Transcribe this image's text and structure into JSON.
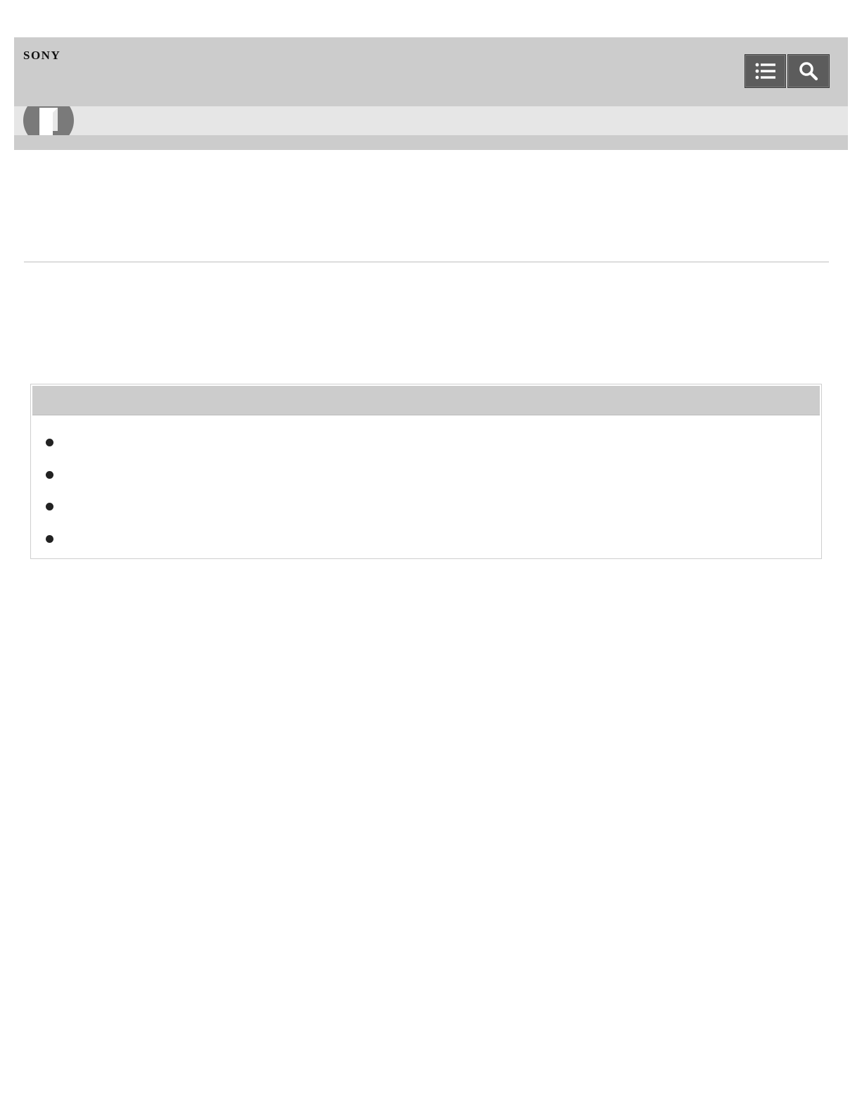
{
  "header": {
    "brand": "SONY",
    "buttons": [
      {
        "icon": "list-icon"
      },
      {
        "icon": "search-icon"
      }
    ],
    "section_icon": "book-icon"
  },
  "note_box": {
    "items": [
      "",
      "",
      "",
      ""
    ]
  },
  "colors": {
    "header_bg": "#cccccc",
    "subbar_bg": "#e6e6e6",
    "button_bg": "#5c5c5c",
    "icon_circle": "#7a7a7a"
  }
}
